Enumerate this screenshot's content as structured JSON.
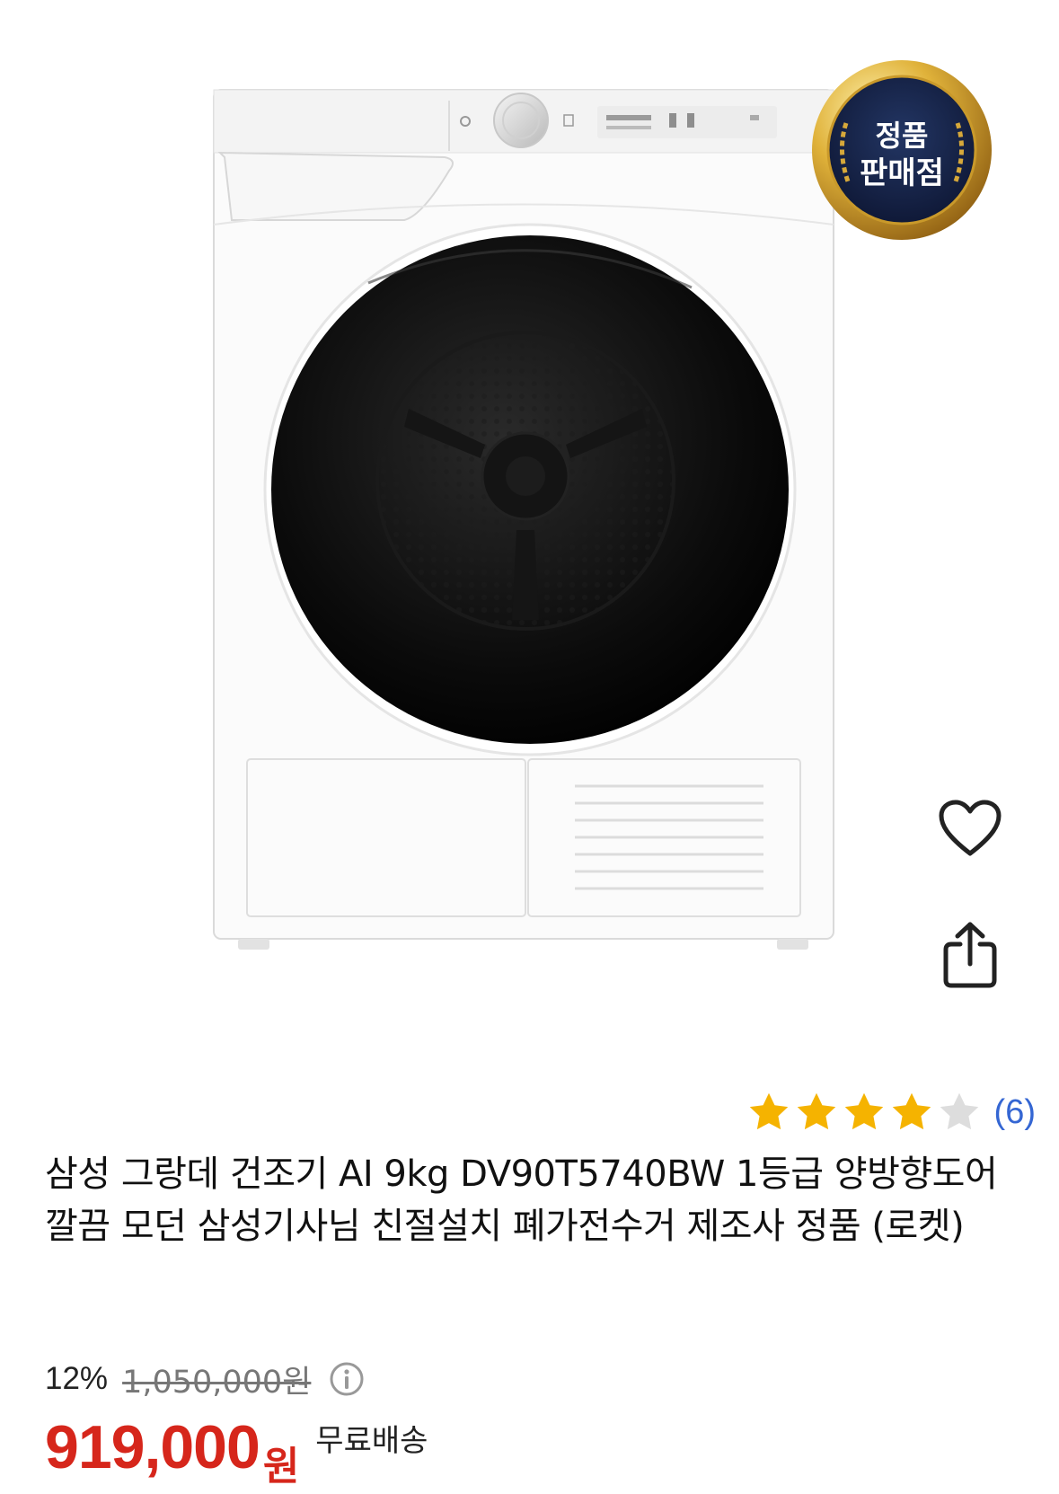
{
  "product": {
    "image_alt": "삼성 그랑데 건조기 제품 이미지",
    "badge": {
      "line1": "정품",
      "line2": "판매점"
    },
    "title": "삼성 그랑데 건조기 AI 9kg DV90T5740BW 1등급 양방향도어 깔끔 모던 삼성기사님 친절설치 폐가전수거 제조사 정품 (로켓)"
  },
  "actions": {
    "wishlist_icon": "heart-outline-icon",
    "share_icon": "share-icon"
  },
  "rating": {
    "stars": 4,
    "max_stars": 5,
    "review_count": "(6)",
    "star_color": "#f5b300",
    "empty_star_color": "#dddddd"
  },
  "price": {
    "discount": "12%",
    "original": "1,050,000원",
    "info_icon": "info-circle-icon",
    "sale_amount": "919,000",
    "sale_unit": "원",
    "shipping": "무료배송",
    "sale_color": "#d6261b"
  }
}
